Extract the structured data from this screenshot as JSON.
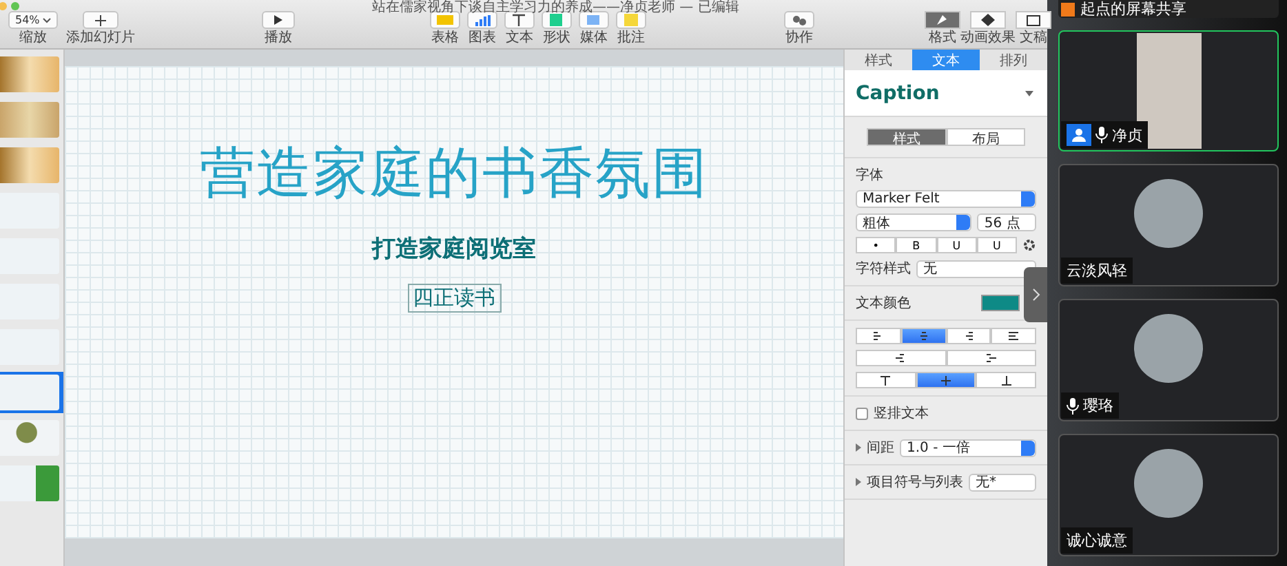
{
  "window": {
    "title": "站在儒家视角下谈自主学习力的养成——净贞老师 — 已编辑"
  },
  "toolbar": {
    "zoom": {
      "value": "54%",
      "label": "缩放"
    },
    "add_slide": {
      "label": "添加幻灯片"
    },
    "play": {
      "label": "播放"
    },
    "insert_tools": [
      {
        "kind": "table",
        "label": "表格"
      },
      {
        "kind": "chart",
        "label": "图表"
      },
      {
        "kind": "text",
        "label": "文本"
      },
      {
        "kind": "shape",
        "label": "形状"
      },
      {
        "kind": "media",
        "label": "媒体"
      },
      {
        "kind": "comment",
        "label": "批注"
      }
    ],
    "collaborate": {
      "label": "协作"
    },
    "inspector_tabs": [
      {
        "kind": "format",
        "label": "格式",
        "selected": true
      },
      {
        "kind": "animate",
        "label": "动画效果",
        "selected": false
      },
      {
        "kind": "document",
        "label": "文稿",
        "selected": false
      }
    ]
  },
  "slides": [
    {
      "kind": "image",
      "selected": false
    },
    {
      "kind": "scroll",
      "selected": false
    },
    {
      "kind": "image",
      "selected": false
    },
    {
      "kind": "text",
      "selected": false
    },
    {
      "kind": "text",
      "selected": false
    },
    {
      "kind": "text",
      "selected": false
    },
    {
      "kind": "text",
      "selected": false
    },
    {
      "kind": "text",
      "selected": true
    },
    {
      "kind": "photo",
      "selected": false
    },
    {
      "kind": "qr",
      "selected": false
    }
  ],
  "slide": {
    "title": "营造家庭的书香氛围",
    "subtitle": "打造家庭阅览室",
    "selected_text": "四正读书"
  },
  "inspector": {
    "tabs": [
      {
        "label": "样式",
        "selected": false
      },
      {
        "label": "文本",
        "selected": true
      },
      {
        "label": "排列",
        "selected": false
      }
    ],
    "paragraph_style": "Caption",
    "sub_tabs": [
      {
        "label": "样式",
        "selected": true
      },
      {
        "label": "布局",
        "selected": false
      }
    ],
    "font_label": "字体",
    "font": "Marker Felt",
    "typeface": "粗体",
    "size": "56 点",
    "style_buttons": [
      "•",
      "B",
      "U",
      "U"
    ],
    "char_style_label": "字符样式",
    "char_style": "无",
    "text_color": {
      "label": "文本颜色",
      "color": "#0e8a86"
    },
    "align": [
      {
        "kind": "left",
        "selected": false
      },
      {
        "kind": "center",
        "selected": true
      },
      {
        "kind": "right",
        "selected": false
      },
      {
        "kind": "justify",
        "selected": false
      }
    ],
    "indent": [
      {
        "kind": "outdent"
      },
      {
        "kind": "indent"
      }
    ],
    "vertical": [
      {
        "kind": "top",
        "selected": false
      },
      {
        "kind": "middle",
        "selected": true
      },
      {
        "kind": "bottom",
        "selected": false
      }
    ],
    "vertical_text": {
      "label": "竖排文本",
      "checked": false
    },
    "spacing": {
      "label": "间距",
      "value": "1.0 - 一倍"
    },
    "bullets": {
      "label": "项目符号与列表",
      "value": "无*"
    }
  },
  "meeting": {
    "banner": "起点的屏幕共享",
    "participants": [
      {
        "name": "净贞",
        "kind": "video",
        "mic": true,
        "host": true,
        "active": true
      },
      {
        "name": "云淡风轻",
        "kind": "avatar",
        "mic": false,
        "host": false,
        "active": false
      },
      {
        "name": "璎珞",
        "kind": "avatar",
        "mic": true,
        "host": false,
        "active": false
      },
      {
        "name": "诚心诚意",
        "kind": "avatar",
        "mic": false,
        "host": false,
        "active": false
      }
    ]
  }
}
